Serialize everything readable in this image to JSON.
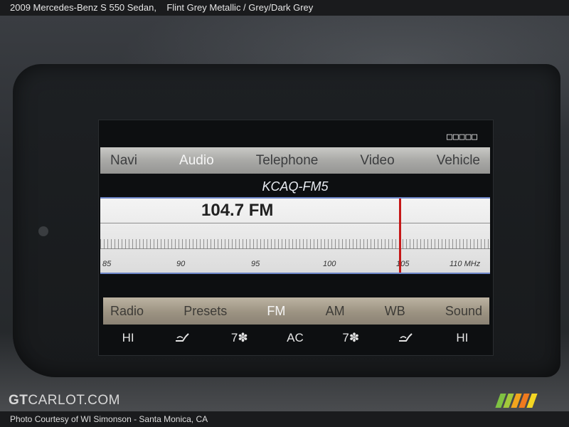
{
  "page_header": {
    "title": "2009 Mercedes-Benz S 550 Sedan,",
    "subtitle": "Flint Grey Metallic / Grey/Dark Grey"
  },
  "screen": {
    "status_text": "□□□□□",
    "main_menu": [
      "Navi",
      "Audio",
      "Telephone",
      "Video",
      "Vehicle"
    ],
    "main_menu_active": "Audio",
    "station_name": "KCAQ-FM5",
    "frequency": "104.7 FM",
    "tuned_value_mhz": 104.7,
    "scale_labels": [
      "85",
      "90",
      "95",
      "100",
      "105",
      "110 MHz"
    ],
    "sub_menu": [
      "Radio",
      "Presets",
      "FM",
      "AM",
      "WB",
      "Sound"
    ],
    "sub_menu_active": "FM",
    "climate": [
      "HI",
      "seat-icon",
      "7",
      "AC",
      "7",
      "seat-icon",
      "HI"
    ]
  },
  "watermark": {
    "logo": "GTCARLOT.COM",
    "logo_part1": "GT",
    "logo_part2": "CARLOT.COM",
    "stripe_colors": [
      "#7fc242",
      "#a2c93b",
      "#f2a51d",
      "#f07a1e",
      "#f4d623"
    ]
  },
  "footer": {
    "credit": "Photo Courtesy of WI Simonson - Santa Monica, CA"
  },
  "colors": {
    "needle": "#c51818",
    "active_text": "#f6f6f6",
    "tuner_border": "#6d86c8"
  }
}
